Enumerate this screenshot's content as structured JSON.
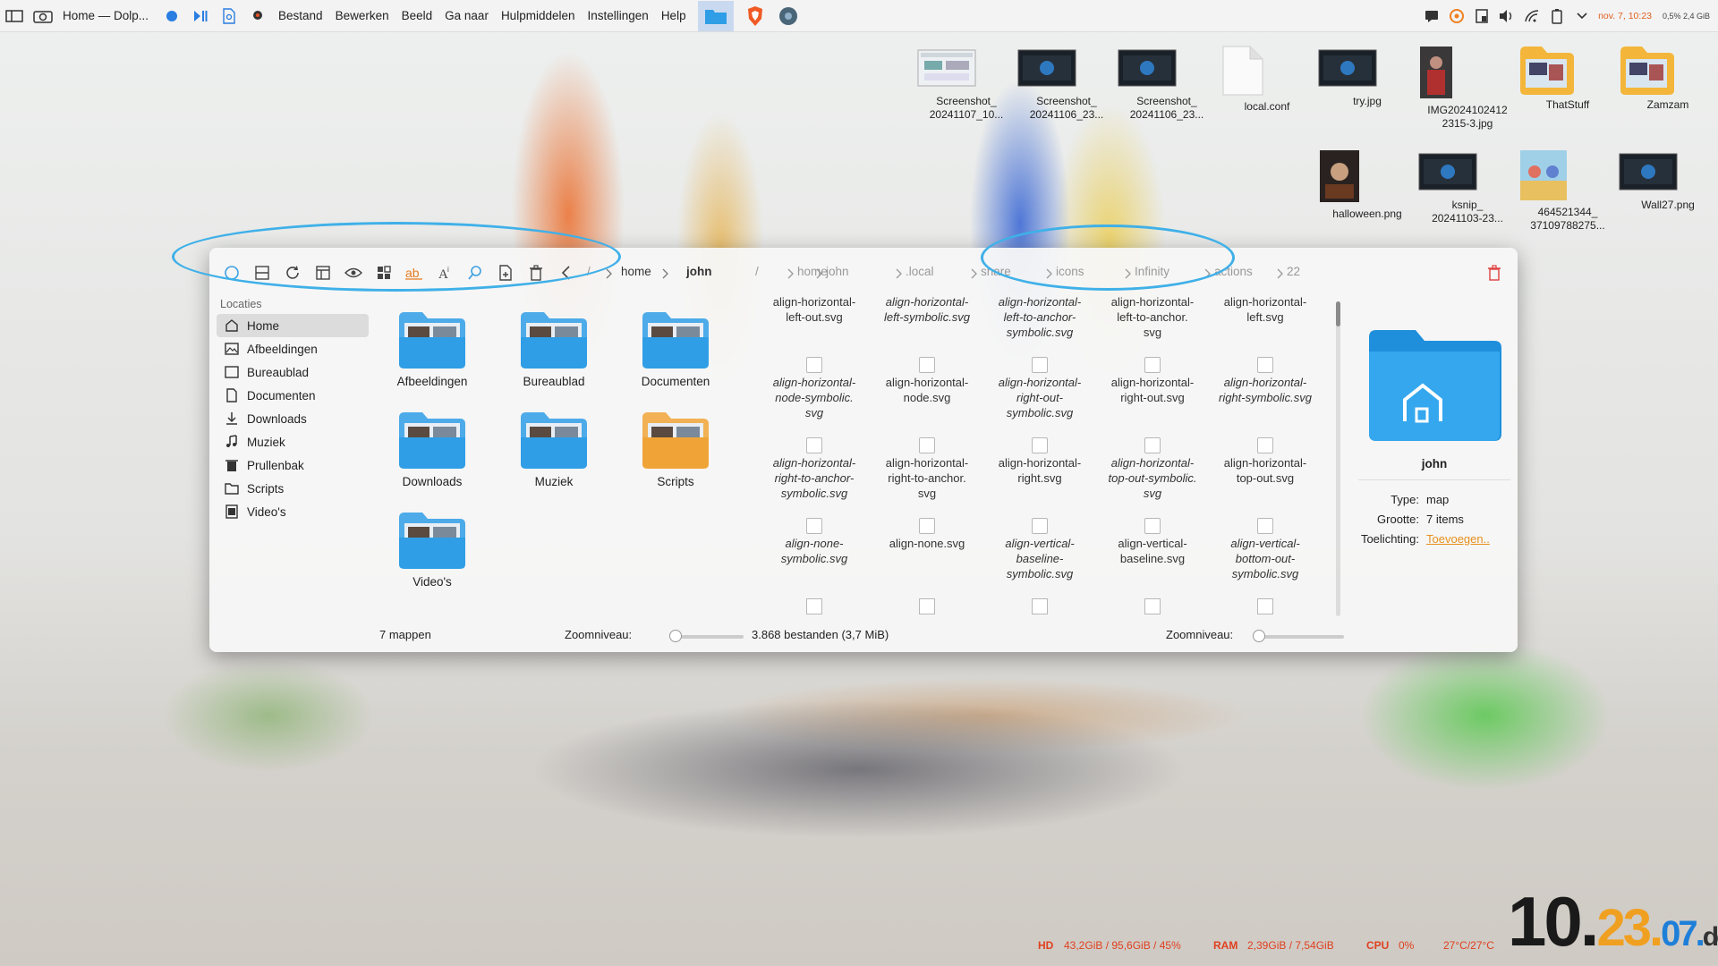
{
  "topbar": {
    "window_title": "Home — Dolp...",
    "menu": [
      "Bestand",
      "Bewerken",
      "Beeld",
      "Ga naar",
      "Hulpmiddelen",
      "Instellingen",
      "Help"
    ],
    "date": "nov. 7, 10:23",
    "mem_usage": "0,5% 2,4 GiB"
  },
  "desktop_icons": [
    {
      "label": "Screenshot_ 20241107_10...",
      "kind": "screenshot-light"
    },
    {
      "label": "Screenshot_ 20241106_23...",
      "kind": "screenshot-dark"
    },
    {
      "label": "Screenshot_ 20241106_23...",
      "kind": "screenshot-dark"
    },
    {
      "label": "local.conf",
      "kind": "document"
    },
    {
      "label": "try.jpg",
      "kind": "photo-dark"
    },
    {
      "label": "IMG2024102412 2315-3.jpg",
      "kind": "photo-portrait"
    },
    {
      "label": "ThatStuff",
      "kind": "folder"
    },
    {
      "label": "Zamzam",
      "kind": "folder"
    },
    {
      "label": "halloween.png",
      "kind": "photo"
    },
    {
      "label": "ksnip_ 20241103-23...",
      "kind": "screenshot-dark"
    },
    {
      "label": "464521344_ 37109788275...",
      "kind": "photo-cartoon"
    },
    {
      "label": "Wall27.png",
      "kind": "photo-dark"
    }
  ],
  "dolphin": {
    "breadcrumb_left": [
      "home",
      "john"
    ],
    "breadcrumb_right": [
      "/",
      "home",
      "john",
      ".local",
      "share",
      "icons",
      "Infinity",
      "actions",
      "22"
    ],
    "sidebar_header": "Locaties",
    "sidebar": [
      {
        "label": "Home",
        "icon": "home-icon",
        "selected": true
      },
      {
        "label": "Afbeeldingen",
        "icon": "pictures-icon"
      },
      {
        "label": "Bureaublad",
        "icon": "desktop-icon"
      },
      {
        "label": "Documenten",
        "icon": "documents-icon"
      },
      {
        "label": "Downloads",
        "icon": "downloads-icon"
      },
      {
        "label": "Muziek",
        "icon": "music-icon"
      },
      {
        "label": "Prullenbak",
        "icon": "trash-icon"
      },
      {
        "label": "Scripts",
        "icon": "folder-icon"
      },
      {
        "label": "Video's",
        "icon": "video-icon"
      }
    ],
    "folders": [
      {
        "label": "Afbeeldingen",
        "color": "#2f9ee6"
      },
      {
        "label": "Bureaublad",
        "color": "#2f9ee6"
      },
      {
        "label": "Documenten",
        "color": "#2f9ee6"
      },
      {
        "label": "Downloads",
        "color": "#2f9ee6"
      },
      {
        "label": "Muziek",
        "color": "#2f9ee6"
      },
      {
        "label": "Scripts",
        "color": "#f0a437"
      },
      {
        "label": "Video's",
        "color": "#2f9ee6"
      }
    ],
    "files": [
      {
        "name": "align-horizontal-\nleft-out.svg",
        "italic": false
      },
      {
        "name": "align-horizontal-\nleft-symbolic.svg",
        "italic": true
      },
      {
        "name": "align-horizontal-\nleft-to-anchor-\nsymbolic.svg",
        "italic": true
      },
      {
        "name": "align-horizontal-\nleft-to-anchor.\nsvg",
        "italic": false
      },
      {
        "name": "align-horizontal-\nleft.svg",
        "italic": false
      },
      {
        "name": "align-horizontal-\nnode-symbolic.\nsvg",
        "italic": true
      },
      {
        "name": "align-horizontal-\nnode.svg",
        "italic": false
      },
      {
        "name": "align-horizontal-\nright-out-\nsymbolic.svg",
        "italic": true
      },
      {
        "name": "align-horizontal-\nright-out.svg",
        "italic": false
      },
      {
        "name": "align-horizontal-\nright-symbolic.svg",
        "italic": true
      },
      {
        "name": "align-horizontal-\nright-to-anchor-\nsymbolic.svg",
        "italic": true
      },
      {
        "name": "align-horizontal-\nright-to-anchor.\nsvg",
        "italic": false
      },
      {
        "name": "align-horizontal-\nright.svg",
        "italic": false
      },
      {
        "name": "align-horizontal-\ntop-out-symbolic.\nsvg",
        "italic": true
      },
      {
        "name": "align-horizontal-\ntop-out.svg",
        "italic": false
      },
      {
        "name": "align-none-\nsymbolic.svg",
        "italic": true
      },
      {
        "name": "align-none.svg",
        "italic": false
      },
      {
        "name": "align-vertical-\nbaseline-\nsymbolic.svg",
        "italic": true
      },
      {
        "name": "align-vertical-\nbaseline.svg",
        "italic": false
      },
      {
        "name": "align-vertical-\nbottom-out-\nsymbolic.svg",
        "italic": true
      }
    ],
    "info": {
      "name": "john",
      "type_label": "Type:",
      "type_value": "map",
      "size_label": "Grootte:",
      "size_value": "7 items",
      "comment_label": "Toelichting:",
      "comment_value": "Toevoegen.."
    },
    "status": {
      "left_count": "7 mappen",
      "zoom_label_left": "Zoomniveau:",
      "right_count": "3.868 bestanden (3,7 MiB)",
      "zoom_label_right": "Zoomniveau:",
      "zoom_left": 0.05,
      "zoom_right": 0.05
    }
  },
  "system": {
    "hd_label": "HD",
    "hd_value": "43,2GiB / 95,6GiB / 45%",
    "ram_label": "RAM",
    "ram_value": "2,39GiB / 7,54GiB",
    "cpu_label": "CPU",
    "cpu_value": "0%",
    "temp_value": "27°C/27°C"
  },
  "clock": {
    "hour": "10.",
    "minute": "23.",
    "day": "07.",
    "weekday": "do"
  },
  "colors": {
    "accent": "#3fb0e8",
    "folder_blue": "#2f9ee6",
    "orange": "#e6901c",
    "clock_hour": "#1a1a1a",
    "clock_minute": "#f0a020",
    "clock_day": "#1e7fd8",
    "clock_weekday": "#333"
  }
}
